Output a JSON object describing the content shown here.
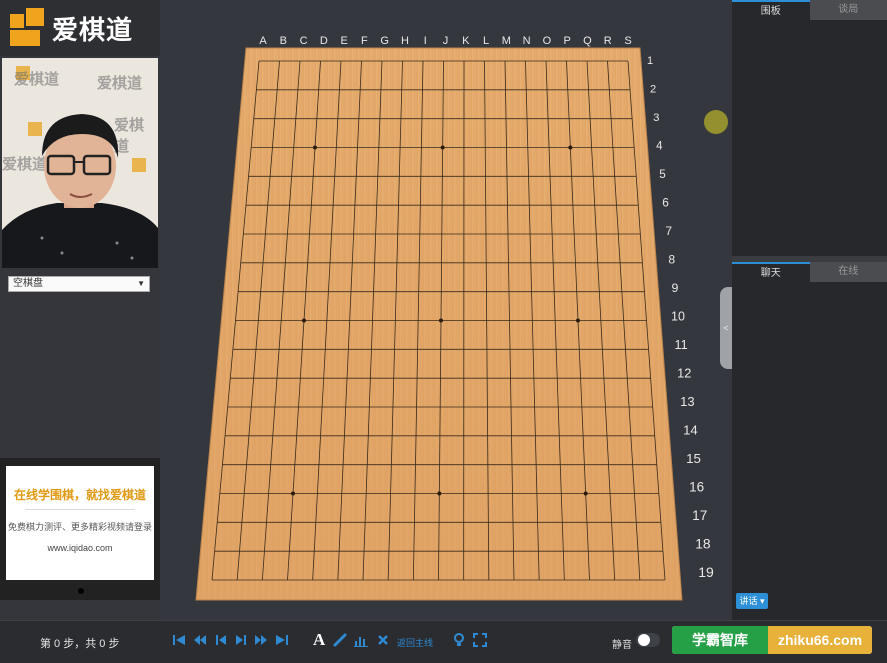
{
  "brand": {
    "name": "爱棋道"
  },
  "video": {
    "background_words": [
      "爱棋道",
      "爱棋道",
      "爱棋道",
      "爱棋道"
    ]
  },
  "board_select": {
    "value": "空棋盘"
  },
  "ad": {
    "title": "在线学围棋，就找爱棋道",
    "subtitle": "免费棋力测评、更多精彩视频请登录",
    "url": "www.iqidao.com"
  },
  "board": {
    "columns": [
      "A",
      "B",
      "C",
      "D",
      "E",
      "F",
      "G",
      "H",
      "I",
      "J",
      "K",
      "L",
      "M",
      "N",
      "O",
      "P",
      "Q",
      "R",
      "S"
    ],
    "rows": [
      "1",
      "2",
      "3",
      "4",
      "5",
      "6",
      "7",
      "8",
      "9",
      "10",
      "11",
      "12",
      "13",
      "14",
      "15",
      "16",
      "17",
      "18",
      "19"
    ]
  },
  "right_panel": {
    "top_tabs": [
      {
        "label": "围板"
      },
      {
        "label": "谈局"
      }
    ],
    "bottom_tabs": [
      {
        "label": "聊天"
      },
      {
        "label": "在线"
      }
    ],
    "collapse_label": "<",
    "chat_button": "讲话 ▾"
  },
  "footer": {
    "step_text": "第 0 步，共 0 步",
    "text_tool": "A",
    "main_line_label": "返回主线",
    "mute_label": "静音"
  },
  "watermark": {
    "left": "学霸智库",
    "right": "zhiku66.com"
  },
  "colors": {
    "accent": "#2f8ad2",
    "board_wood": "#e3a96a",
    "brand_orange": "#f0a41e"
  }
}
